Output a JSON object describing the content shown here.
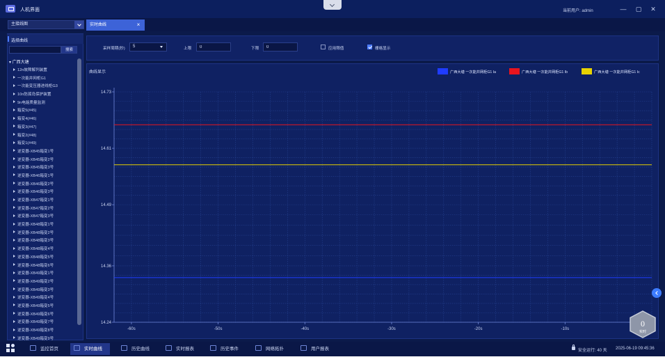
{
  "window": {
    "title": "人机界面",
    "current_user": "当前用户: admin",
    "minimize": "—",
    "maximize": "▢",
    "close": "✕"
  },
  "toolbar": {
    "mode_select_value": "主接线图",
    "active_tab": "实时曲线",
    "tab_close": "×"
  },
  "sidebar": {
    "header": "选择曲线",
    "search_placeholder": "",
    "search_button": "搜索",
    "root": "▾ 广西大塘",
    "items": [
      "12n故障解列装置",
      "一次能并网柜G1",
      "一次能变压器进线柜G3",
      "10n防孤岛保护装置",
      "9n电能质量监测",
      "箱变5(#45)",
      "箱变4(#46)",
      "箱变3(#47)",
      "箱变2(#48)",
      "箱变1(#49)",
      "逆变器-XB45箱变1号",
      "逆变器-XB45箱变2号",
      "逆变器-XB45箱变3号",
      "逆变器-XB46箱变1号",
      "逆变器-XB46箱变2号",
      "逆变器-XB46箱变3号",
      "逆变器-XB47箱变1号",
      "逆变器-XB47箱变2号",
      "逆变器-XB47箱变3号",
      "逆变器-XB48箱变1号",
      "逆变器-XB48箱变2号",
      "逆变器-XB48箱变3号",
      "逆变器-XB48箱变4号",
      "逆变器-XB48箱变5号",
      "逆变器-XB48箱变6号",
      "逆变器-XB49箱变1号",
      "逆变器-XB49箱变2号",
      "逆变器-XB49箱变3号",
      "逆变器-XB49箱变4号",
      "逆变器-XB49箱变5号",
      "逆变器-XB49箱变6号",
      "逆变器-XB49箱变7号",
      "逆变器-XB49箱变8号",
      "逆变器-XB49箱变9号"
    ]
  },
  "filters": {
    "period_label": "采样周期(秒)",
    "period_value": "5",
    "upper_label": "上限",
    "upper_value": "0",
    "lower_label": "下限",
    "lower_value": "0",
    "apply_threshold_label": "应用限值",
    "apply_threshold_checked": false,
    "grid_label": "栅格显示",
    "grid_checked": true
  },
  "chart_data": {
    "type": "line",
    "title": "曲线显示",
    "xlabel": "",
    "ylabel": "",
    "x_ticks": [
      "-60s",
      "-50s",
      "-40s",
      "-30s",
      "-20s",
      "-10s"
    ],
    "y_ticks": [
      "14.73",
      "14.61",
      "14.49",
      "14.36",
      "14.24"
    ],
    "xlim": [
      -62,
      0
    ],
    "ylim": [
      14.24,
      14.73
    ],
    "grid": true,
    "legend_position": "top-right",
    "series": [
      {
        "name": "广西大塘 一次能并网柜G1 Ia",
        "color": "#1f3cff",
        "x": [
          -62,
          0
        ],
        "y": [
          14.335,
          14.335
        ]
      },
      {
        "name": "广西大塘 一次能并网柜G1 Ib",
        "color": "#e8141e",
        "x": [
          -62,
          0
        ],
        "y": [
          14.66,
          14.66
        ]
      },
      {
        "name": "广西大塘 一次能并网柜G1 Ic",
        "color": "#e8d200",
        "x": [
          -62,
          0
        ],
        "y": [
          14.575,
          14.575
        ]
      }
    ]
  },
  "badge": {
    "value": "0",
    "label": "实时"
  },
  "taskbar": {
    "items": [
      {
        "label": "监控首页",
        "active": false
      },
      {
        "label": "实时曲线",
        "active": true
      },
      {
        "label": "历史曲线",
        "active": false
      },
      {
        "label": "实时报表",
        "active": false
      },
      {
        "label": "历史事件",
        "active": false
      },
      {
        "label": "网络拓扑",
        "active": false
      },
      {
        "label": "用户报表",
        "active": false
      }
    ],
    "safe_run": "安全运行: 40 天",
    "datetime": "2025-06-19 09:45:36"
  },
  "colors": {
    "background": "#0b1a4a",
    "panel": "#0f2162",
    "accent": "#3d63d8"
  }
}
